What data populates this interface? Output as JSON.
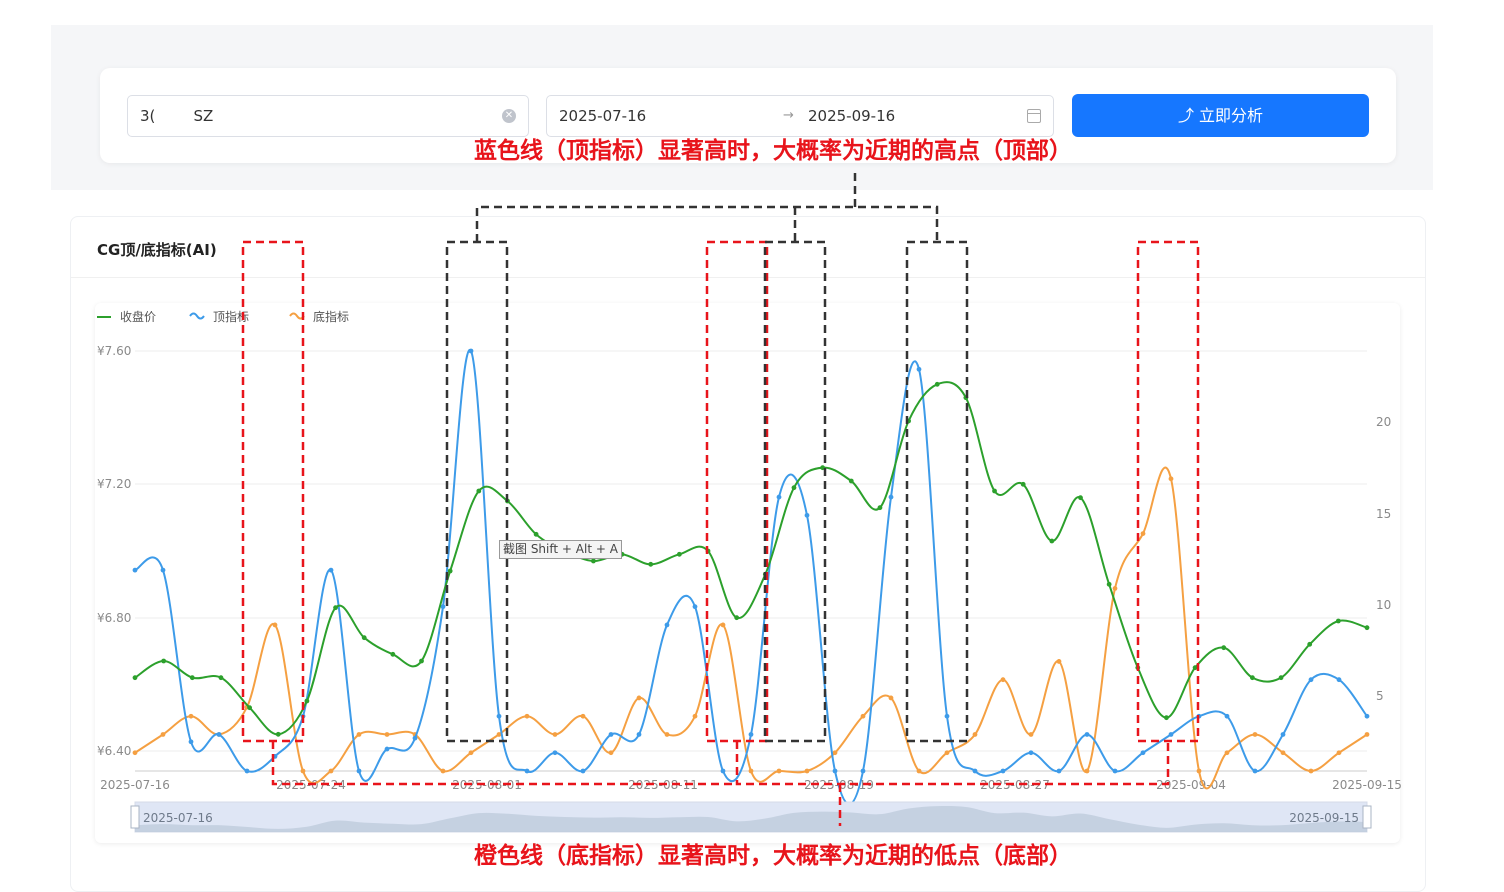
{
  "search": {
    "stock_code": "3(        SZ",
    "clear_icon": "clear-icon",
    "date_start": "2025-07-16",
    "date_arrow": "→",
    "date_end": "2025-09-16",
    "calendar_icon": "calendar-icon",
    "analyze_icon": "⤴",
    "analyze_label": "立即分析"
  },
  "card": {
    "title": "CG顶/底指标(AI)"
  },
  "annotations": {
    "top_text": "蓝色线（顶指标）显著高时，大概率为近期的高点（顶部）",
    "bottom_text": "橙色线（底指标）显著高时，大概率为近期的低点（底部）"
  },
  "tooltip": "截图 Shift + Alt + A",
  "colors": {
    "close": "#2ca02c",
    "top": "#3d9be9",
    "bottom": "#f5a042",
    "annotation": "#e8141b",
    "button": "#1677ff"
  },
  "chart_data": {
    "type": "line",
    "x_labels": [
      "2025-07-16",
      "2025-07-24",
      "2025-08-01",
      "2025-08-11",
      "2025-08-19",
      "2025-08-27",
      "2025-09-04",
      "2025-09-15"
    ],
    "ylabel_left_ticks": [
      "¥7.60",
      "¥7.20",
      "¥6.80",
      "¥6.40"
    ],
    "ylim_left": [
      6.4,
      7.6
    ],
    "yticks_right": [
      "20",
      "15",
      "10",
      "5"
    ],
    "ylim_right": [
      0,
      23
    ],
    "legend": [
      "收盘价",
      "顶指标",
      "底指标"
    ],
    "legend_placement": "top-left",
    "dataZoom": {
      "start_label": "2025-07-16",
      "end_label": "2025-09-15"
    },
    "series": [
      {
        "name": "收盘价",
        "axis": "left",
        "values": [
          6.62,
          6.67,
          6.62,
          6.62,
          6.53,
          6.45,
          6.55,
          6.83,
          6.74,
          6.69,
          6.67,
          6.94,
          7.18,
          7.15,
          7.05,
          7.0,
          6.97,
          6.99,
          6.96,
          6.99,
          7.0,
          6.8,
          6.93,
          7.19,
          7.25,
          7.21,
          7.13,
          7.39,
          7.5,
          7.46,
          7.18,
          7.2,
          7.03,
          7.16,
          6.9,
          6.65,
          6.5,
          6.65,
          6.71,
          6.62,
          6.62,
          6.72,
          6.79,
          6.77
        ]
      },
      {
        "name": "顶指标",
        "axis": "right",
        "values": [
          11,
          11,
          1.6,
          2,
          0,
          0.8,
          3,
          11,
          0,
          1.2,
          1.8,
          9,
          23,
          3,
          0,
          1,
          0,
          2,
          2,
          8,
          9,
          0,
          2,
          15,
          14,
          0,
          0,
          15,
          22,
          3,
          0,
          0,
          1,
          0,
          2,
          0,
          1,
          2,
          3,
          3,
          0,
          2,
          5,
          5,
          3
        ]
      },
      {
        "name": "底指标",
        "axis": "right",
        "values": [
          1,
          2,
          3,
          2,
          3.5,
          8,
          0,
          0,
          2,
          2,
          2,
          0,
          1,
          2,
          3,
          2,
          3,
          1,
          4,
          2,
          3,
          8,
          0,
          0,
          0,
          1,
          3,
          4,
          0,
          1,
          2,
          5,
          2,
          6,
          0,
          10,
          13,
          16,
          0,
          1,
          2,
          1,
          0,
          1,
          2
        ]
      }
    ]
  }
}
